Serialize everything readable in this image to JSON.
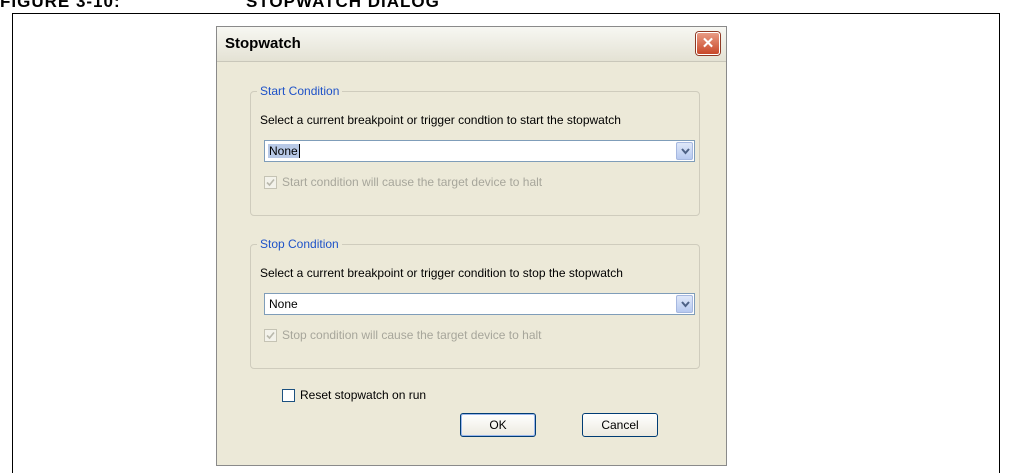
{
  "figure": {
    "caption_number": "FIGURE 3-10:",
    "caption_title": "STOPWATCH DIALOG"
  },
  "dialog": {
    "title": "Stopwatch",
    "close_glyph": "✕",
    "start_group": {
      "legend": "Start Condition",
      "description": "Select a current breakpoint or trigger condtion to start the stopwatch",
      "selected_value": "None",
      "halt_label": "Start condition will cause the target device to halt",
      "halt_checked": true,
      "halt_enabled": false
    },
    "stop_group": {
      "legend": "Stop Condition",
      "description": "Select a current breakpoint or trigger condition to stop the stopwatch",
      "selected_value": "None",
      "halt_label": "Stop condition will cause the target device to halt",
      "halt_checked": true,
      "halt_enabled": false
    },
    "reset": {
      "label": "Reset stopwatch on run",
      "checked": false
    },
    "ok_label": "OK",
    "cancel_label": "Cancel"
  },
  "icons": {
    "close": "close-icon",
    "dropdown": "chevron-down-icon",
    "check": "checkmark-icon"
  },
  "colors": {
    "dialog_bg": "#ece9d8",
    "legend_text": "#1e52c8",
    "close_button": "#c8482a",
    "disabled_text": "#a7a69b"
  }
}
